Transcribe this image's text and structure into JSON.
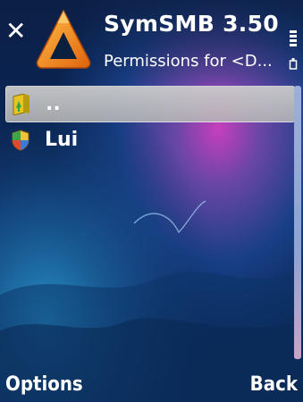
{
  "header": {
    "title": "SymSMB 3.50",
    "subtitle": "Permissions for <D...",
    "close_icon": "close-icon",
    "logo_icon": "symsmb-logo-icon",
    "status_icon": "signal-indicator-icon"
  },
  "list": {
    "items": [
      {
        "label": "..",
        "icon": "folder-up-icon",
        "selected": true
      },
      {
        "label": "Lui",
        "icon": "user-shield-icon",
        "selected": false
      }
    ]
  },
  "softkeys": {
    "left": "Options",
    "right": "Back"
  },
  "colors": {
    "accent_orange": "#f08a1a",
    "background_blue": "#0a2a55",
    "highlight_gray": "#c8c8c8"
  }
}
